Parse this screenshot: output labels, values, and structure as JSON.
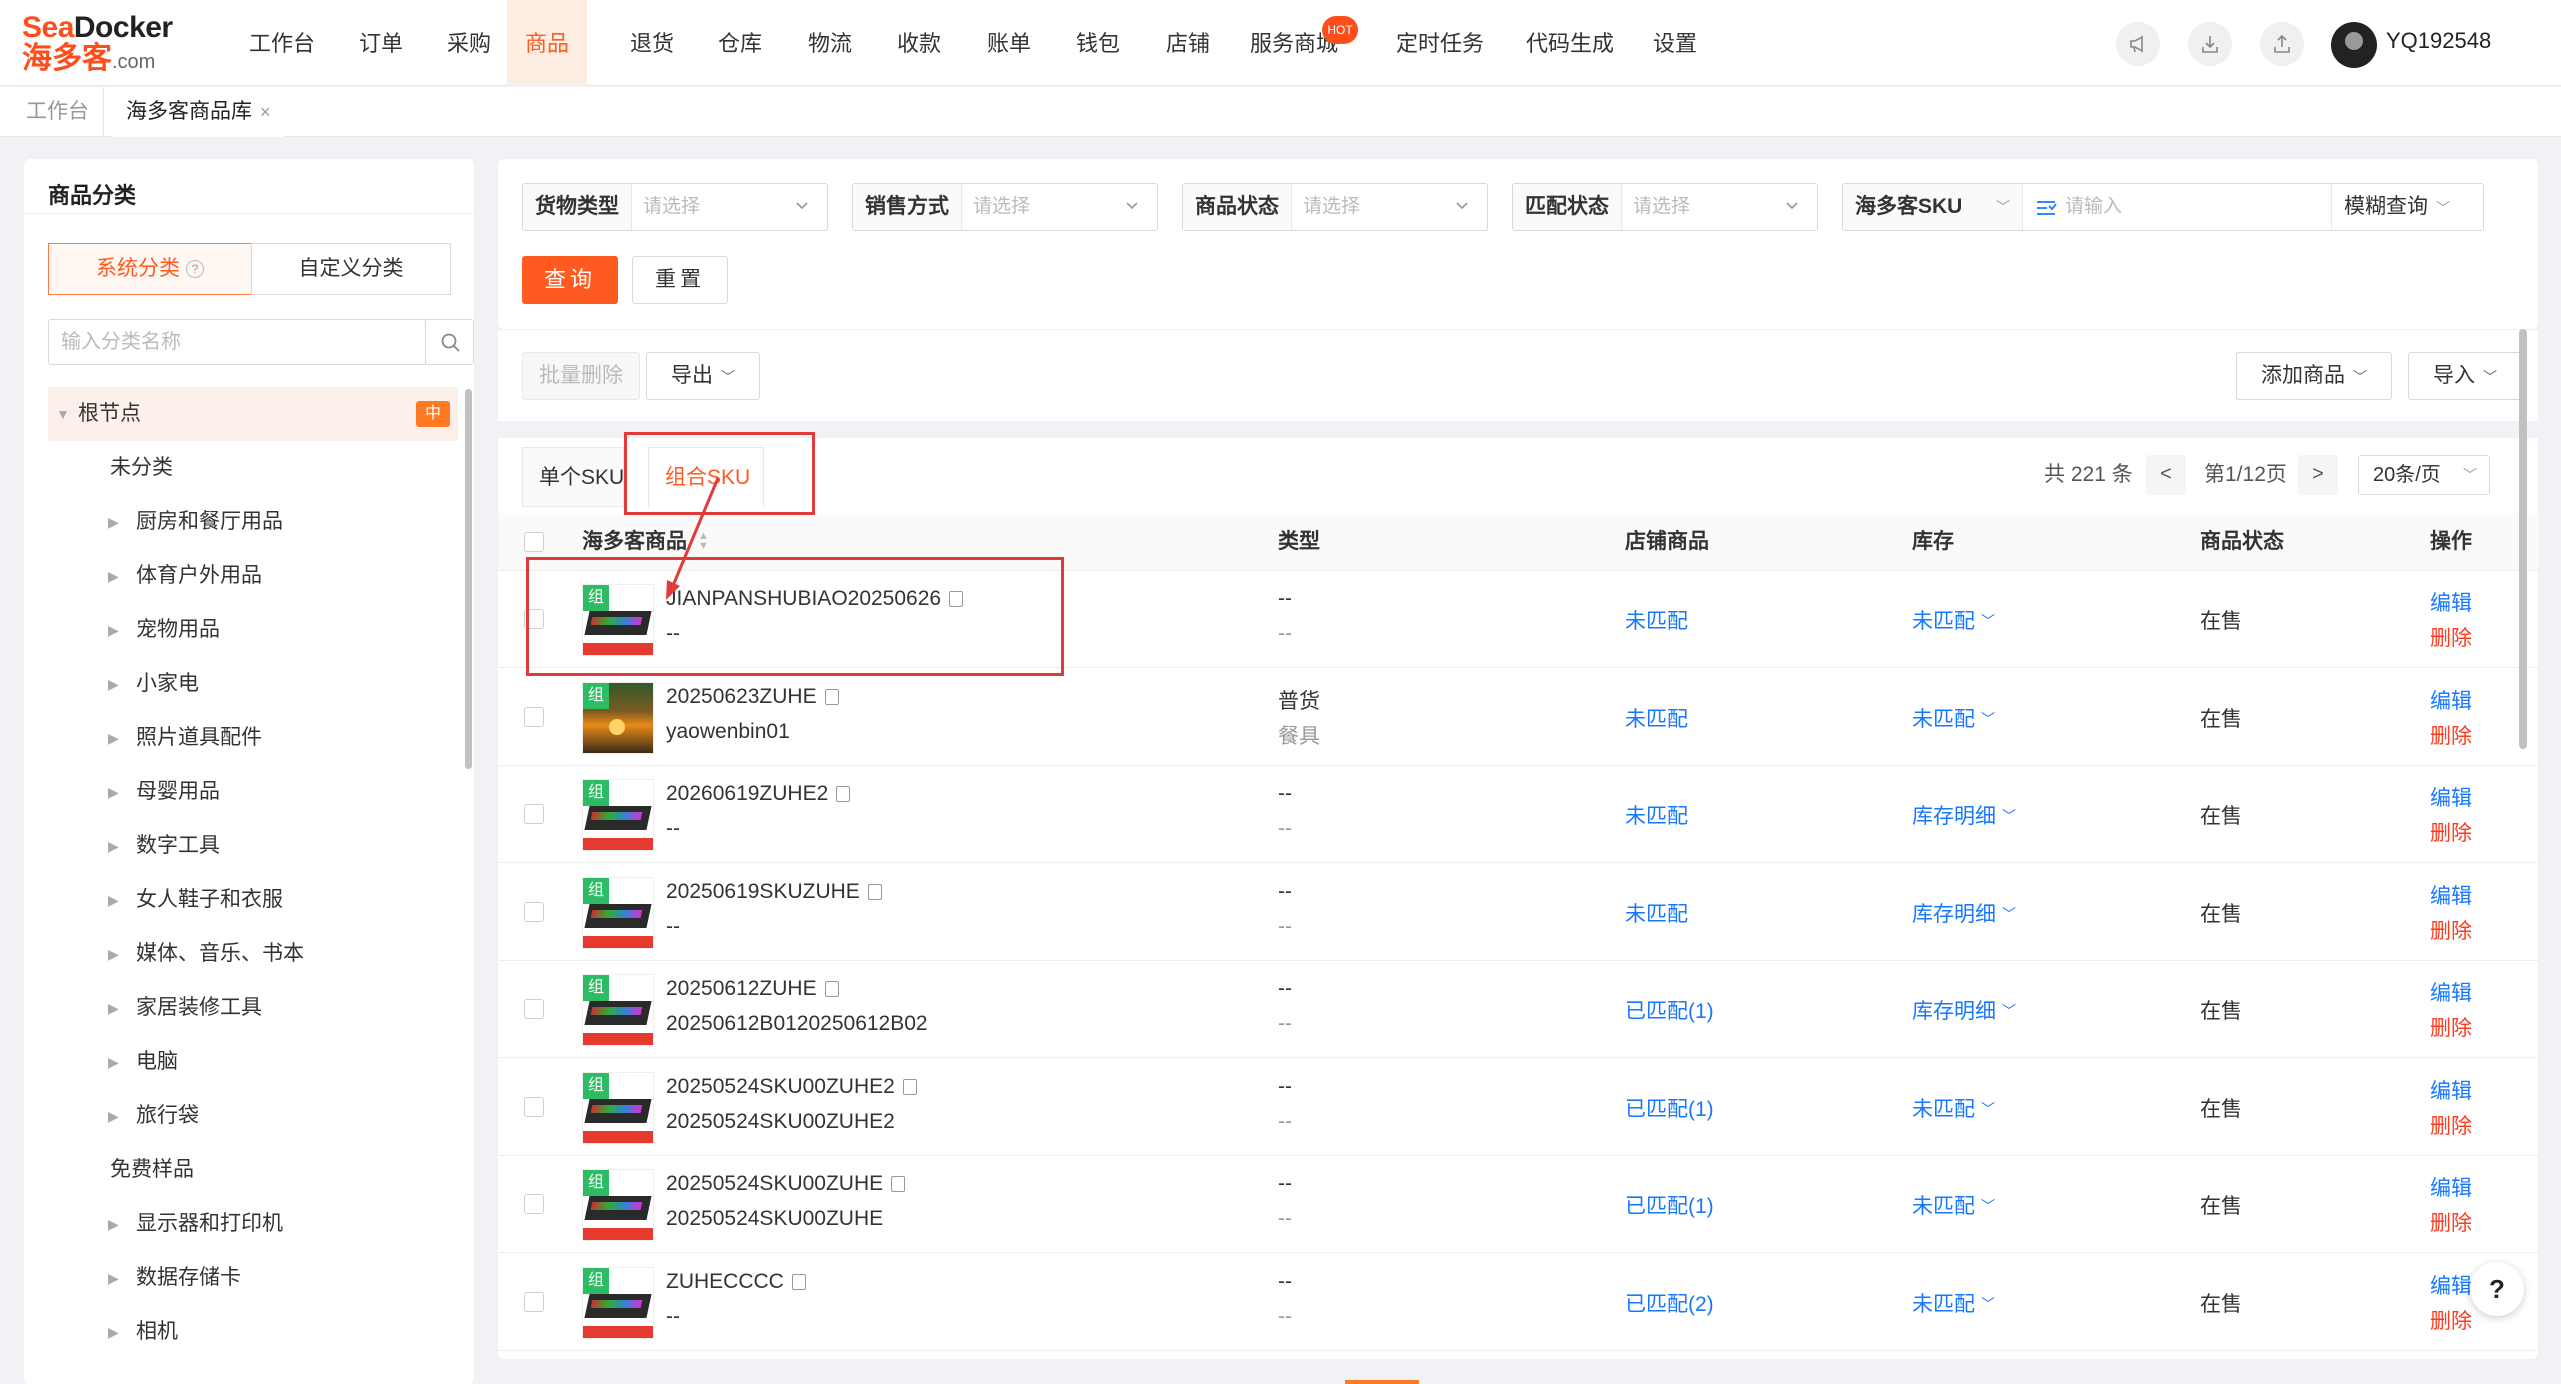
{
  "logo": {
    "line1_a": "Sea",
    "line1_b": "Docker",
    "line2_a": "海多客",
    "line2_b": ".com"
  },
  "nav": {
    "items": [
      "工作台",
      "订单",
      "采购",
      "商品",
      "退货",
      "仓库",
      "物流",
      "收款",
      "账单",
      "钱包",
      "店铺",
      "服务商城",
      "定时任务",
      "代码生成",
      "设置"
    ],
    "active_index": 3,
    "badge": "HOT",
    "username": "YQ192548"
  },
  "tabs": {
    "home": "工作台",
    "current": "海多客商品库",
    "close": "×"
  },
  "sidebar": {
    "title": "商品分类",
    "seg_system": "系统分类",
    "seg_custom": "自定义分类",
    "search_placeholder": "输入分类名称",
    "root_label": "根节点",
    "root_badge": "中",
    "nodes": [
      {
        "label": "未分类",
        "arrow": false
      },
      {
        "label": "厨房和餐厅用品",
        "arrow": true
      },
      {
        "label": "体育户外用品",
        "arrow": true
      },
      {
        "label": "宠物用品",
        "arrow": true
      },
      {
        "label": "小家电",
        "arrow": true
      },
      {
        "label": "照片道具配件",
        "arrow": true
      },
      {
        "label": "母婴用品",
        "arrow": true
      },
      {
        "label": "数字工具",
        "arrow": true
      },
      {
        "label": "女人鞋子和衣服",
        "arrow": true
      },
      {
        "label": "媒体、音乐、书本",
        "arrow": true
      },
      {
        "label": "家居装修工具",
        "arrow": true
      },
      {
        "label": "电脑",
        "arrow": true
      },
      {
        "label": "旅行袋",
        "arrow": true
      },
      {
        "label": "免费样品",
        "arrow": false
      },
      {
        "label": "显示器和打印机",
        "arrow": true
      },
      {
        "label": "数据存储卡",
        "arrow": true
      },
      {
        "label": "相机",
        "arrow": true
      }
    ]
  },
  "filters": {
    "cargo_type": {
      "label": "货物类型",
      "placeholder": "请选择"
    },
    "sale_mode": {
      "label": "销售方式",
      "placeholder": "请选择"
    },
    "goods_status": {
      "label": "商品状态",
      "placeholder": "请选择"
    },
    "match_status": {
      "label": "匹配状态",
      "placeholder": "请选择"
    },
    "sku_select": {
      "label": "海多客SKU",
      "placeholder": "请输入",
      "mode": "模糊查询"
    },
    "query": "查询",
    "reset": "重置"
  },
  "toolbar": {
    "batch_delete": "批量删除",
    "export": "导出",
    "add_goods": "添加商品",
    "import": "导入"
  },
  "subtabs": {
    "single": "单个SKU",
    "combo": "组合SKU"
  },
  "pager": {
    "total": "共 221 条",
    "prev": "<",
    "page": "第1/12页",
    "next": ">",
    "size": "20条/页"
  },
  "table": {
    "headers": {
      "goods": "海多客商品",
      "type": "类型",
      "store": "店铺商品",
      "stock": "库存",
      "status": "商品状态",
      "ops": "操作"
    },
    "rows": [
      {
        "tag": "组",
        "sku": "JIANPANSHUBIAO20250626",
        "sub": "--",
        "type1": "--",
        "type2": "--",
        "store": "未匹配",
        "stock": "未匹配",
        "status": "在售",
        "edit": "编辑",
        "del": "删除",
        "img": "keyboard"
      },
      {
        "tag": "组",
        "sku": "20250623ZUHE",
        "sub": "yaowenbin01",
        "type1": "普货",
        "type2": "餐具",
        "store": "未匹配",
        "stock": "未匹配",
        "status": "在售",
        "edit": "编辑",
        "del": "删除",
        "img": "sunset"
      },
      {
        "tag": "组",
        "sku": "20260619ZUHE2",
        "sub": "--",
        "type1": "--",
        "type2": "--",
        "store": "未匹配",
        "stock": "库存明细",
        "status": "在售",
        "edit": "编辑",
        "del": "删除",
        "img": "keyboard"
      },
      {
        "tag": "组",
        "sku": "20250619SKUZUHE",
        "sub": "--",
        "type1": "--",
        "type2": "--",
        "store": "未匹配",
        "stock": "库存明细",
        "status": "在售",
        "edit": "编辑",
        "del": "删除",
        "img": "keyboard"
      },
      {
        "tag": "组",
        "sku": "20250612ZUHE",
        "sub": "20250612B0120250612B02",
        "type1": "--",
        "type2": "--",
        "store": "已匹配(1)",
        "stock": "库存明细",
        "status": "在售",
        "edit": "编辑",
        "del": "删除",
        "img": "keyboard"
      },
      {
        "tag": "组",
        "sku": "20250524SKU00ZUHE2",
        "sub": "20250524SKU00ZUHE2",
        "type1": "--",
        "type2": "--",
        "store": "已匹配(1)",
        "stock": "未匹配",
        "status": "在售",
        "edit": "编辑",
        "del": "删除",
        "img": "keyboard"
      },
      {
        "tag": "组",
        "sku": "20250524SKU00ZUHE",
        "sub": "20250524SKU00ZUHE",
        "type1": "--",
        "type2": "--",
        "store": "已匹配(1)",
        "stock": "未匹配",
        "status": "在售",
        "edit": "编辑",
        "del": "删除",
        "img": "keyboard"
      },
      {
        "tag": "组",
        "sku": "ZUHECCCC",
        "sub": "--",
        "type1": "--",
        "type2": "--",
        "store": "已匹配(2)",
        "stock": "未匹配",
        "status": "在售",
        "edit": "编辑",
        "del": "删除",
        "img": "keyboard"
      }
    ]
  },
  "help": "?",
  "colors": {
    "accent": "#ff5a1f",
    "link": "#1677ff",
    "danger": "#ff3b1f",
    "annotation": "#e23a3a"
  }
}
